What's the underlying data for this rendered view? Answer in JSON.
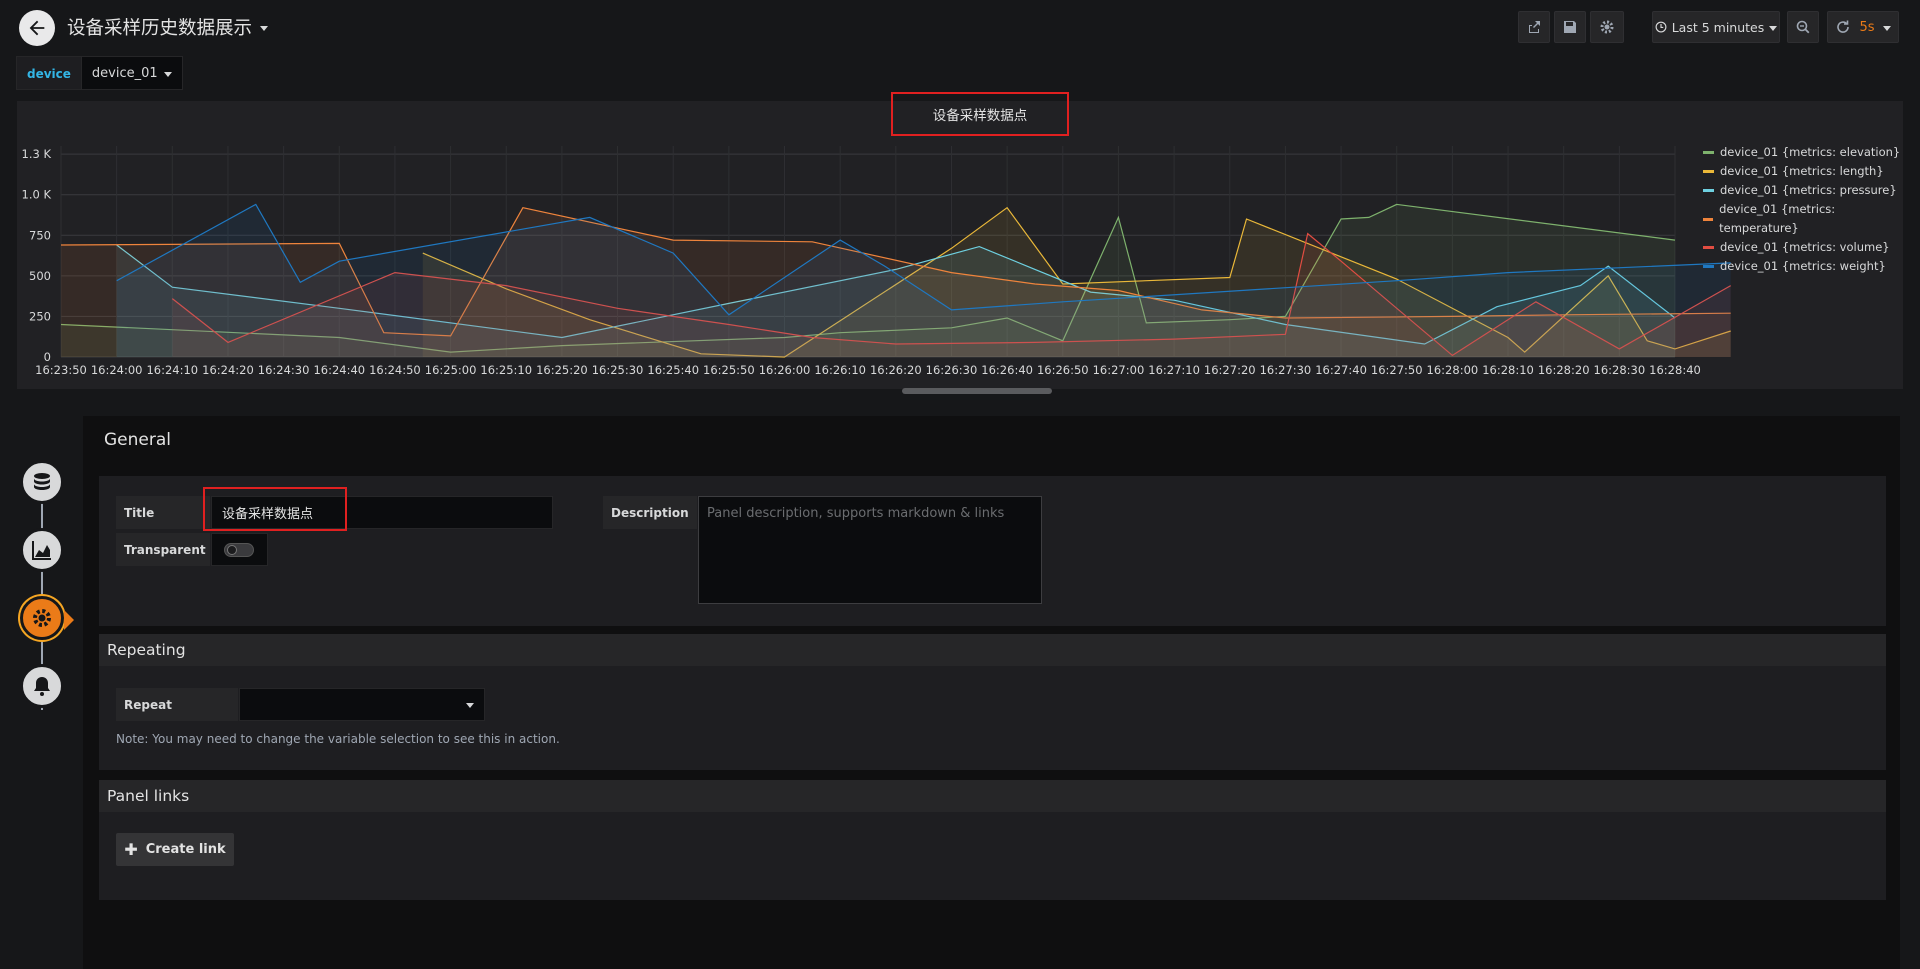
{
  "header": {
    "dashboard_title": "设备采样历史数据展示",
    "time_range": "Last 5 minutes",
    "refresh_interval": "5s"
  },
  "variables": [
    {
      "label": "device",
      "value": "device_01"
    }
  ],
  "panel": {
    "title": "设备采样数据点"
  },
  "chart_data": {
    "type": "line",
    "title": "设备采样数据点",
    "ylim": [
      0,
      1300
    ],
    "yticks": [
      "0",
      "250",
      "500",
      "750",
      "1.0 K",
      "1.3 K"
    ],
    "ytick_values": [
      0,
      250,
      500,
      750,
      1000,
      1250
    ],
    "x_labels": [
      "16:23:50",
      "16:24:00",
      "16:24:10",
      "16:24:20",
      "16:24:30",
      "16:24:40",
      "16:24:50",
      "16:25:00",
      "16:25:10",
      "16:25:20",
      "16:25:30",
      "16:25:40",
      "16:25:50",
      "16:26:00",
      "16:26:10",
      "16:26:20",
      "16:26:30",
      "16:26:40",
      "16:26:50",
      "16:27:00",
      "16:27:10",
      "16:27:20",
      "16:27:30",
      "16:27:40",
      "16:27:50",
      "16:28:00",
      "16:28:10",
      "16:28:20",
      "16:28:30",
      "16:28:40"
    ],
    "grid": true,
    "legend_position": "right",
    "series": [
      {
        "name": "device_01 {metrics: elevation}",
        "color": "#7eb26d",
        "points": [
          [
            0,
            200
          ],
          [
            5,
            120
          ],
          [
            7,
            30
          ],
          [
            9,
            70
          ],
          [
            13,
            120
          ],
          [
            14,
            150
          ],
          [
            16,
            180
          ],
          [
            17,
            240
          ],
          [
            18,
            100
          ],
          [
            19,
            860
          ],
          [
            19.5,
            210
          ],
          [
            21,
            230
          ],
          [
            22,
            250
          ],
          [
            23,
            850
          ],
          [
            23.5,
            860
          ],
          [
            24,
            940
          ],
          [
            29,
            720
          ]
        ]
      },
      {
        "name": "device_01 {metrics: length}",
        "color": "#eab839",
        "points": [
          [
            6.5,
            640
          ],
          [
            8,
            420
          ],
          [
            9.5,
            230
          ],
          [
            11.5,
            20
          ],
          [
            13,
            0
          ],
          [
            16,
            670
          ],
          [
            17,
            920
          ],
          [
            18,
            450
          ],
          [
            19.5,
            470
          ],
          [
            21,
            490
          ],
          [
            21.3,
            850
          ],
          [
            24,
            480
          ],
          [
            26,
            120
          ],
          [
            26.3,
            30
          ],
          [
            27.8,
            500
          ],
          [
            28.5,
            100
          ],
          [
            29,
            50
          ],
          [
            30,
            160
          ]
        ]
      },
      {
        "name": "device_01 {metrics: pressure}",
        "color": "#6ed0e0",
        "points": [
          [
            1,
            690
          ],
          [
            2,
            430
          ],
          [
            5,
            300
          ],
          [
            9,
            120
          ],
          [
            12,
            330
          ],
          [
            15,
            540
          ],
          [
            16.5,
            680
          ],
          [
            17.5,
            540
          ],
          [
            18.5,
            400
          ],
          [
            20,
            350
          ],
          [
            22,
            200
          ],
          [
            24.5,
            80
          ],
          [
            25.8,
            310
          ],
          [
            27.3,
            440
          ],
          [
            27.8,
            560
          ],
          [
            29,
            240
          ]
        ]
      },
      {
        "name": "device_01 {metrics: temperature}",
        "color": "#ef843c",
        "points": [
          [
            0,
            690
          ],
          [
            5,
            700
          ],
          [
            5.8,
            150
          ],
          [
            7,
            130
          ],
          [
            8.3,
            920
          ],
          [
            11,
            720
          ],
          [
            13.5,
            710
          ],
          [
            16,
            520
          ],
          [
            17.5,
            450
          ],
          [
            19,
            410
          ],
          [
            20.5,
            290
          ],
          [
            22,
            240
          ],
          [
            25,
            250
          ],
          [
            27,
            260
          ],
          [
            30,
            270
          ]
        ]
      },
      {
        "name": "device_01 {metrics: volume}",
        "color": "#e24d42",
        "points": [
          [
            2,
            360
          ],
          [
            3,
            90
          ],
          [
            6,
            520
          ],
          [
            8,
            440
          ],
          [
            10,
            300
          ],
          [
            12,
            200
          ],
          [
            13.5,
            120
          ],
          [
            15,
            80
          ],
          [
            17.5,
            90
          ],
          [
            20,
            110
          ],
          [
            22,
            140
          ],
          [
            22.4,
            760
          ],
          [
            23,
            590
          ],
          [
            25,
            10
          ],
          [
            26.5,
            340
          ],
          [
            28,
            50
          ],
          [
            30,
            440
          ]
        ]
      },
      {
        "name": "device_01 {metrics: weight}",
        "color": "#1f78c1",
        "points": [
          [
            1,
            470
          ],
          [
            3.5,
            940
          ],
          [
            4.3,
            460
          ],
          [
            5,
            590
          ],
          [
            9.5,
            860
          ],
          [
            11,
            640
          ],
          [
            12,
            260
          ],
          [
            14,
            720
          ],
          [
            14.8,
            560
          ],
          [
            16,
            290
          ],
          [
            18,
            340
          ],
          [
            24,
            470
          ],
          [
            26,
            520
          ],
          [
            30,
            580
          ]
        ]
      }
    ]
  },
  "editor": {
    "general_title": "General",
    "title_label": "Title",
    "title_value": "设备采样数据点",
    "transparent_label": "Transparent",
    "description_label": "Description",
    "description_placeholder": "Panel description, supports markdown & links",
    "repeating_title": "Repeating",
    "repeat_label": "Repeat",
    "repeat_value": "",
    "repeat_note": "Note: You may need to change the variable selection to see this in action.",
    "panel_links_title": "Panel links",
    "create_link_label": "Create link"
  }
}
